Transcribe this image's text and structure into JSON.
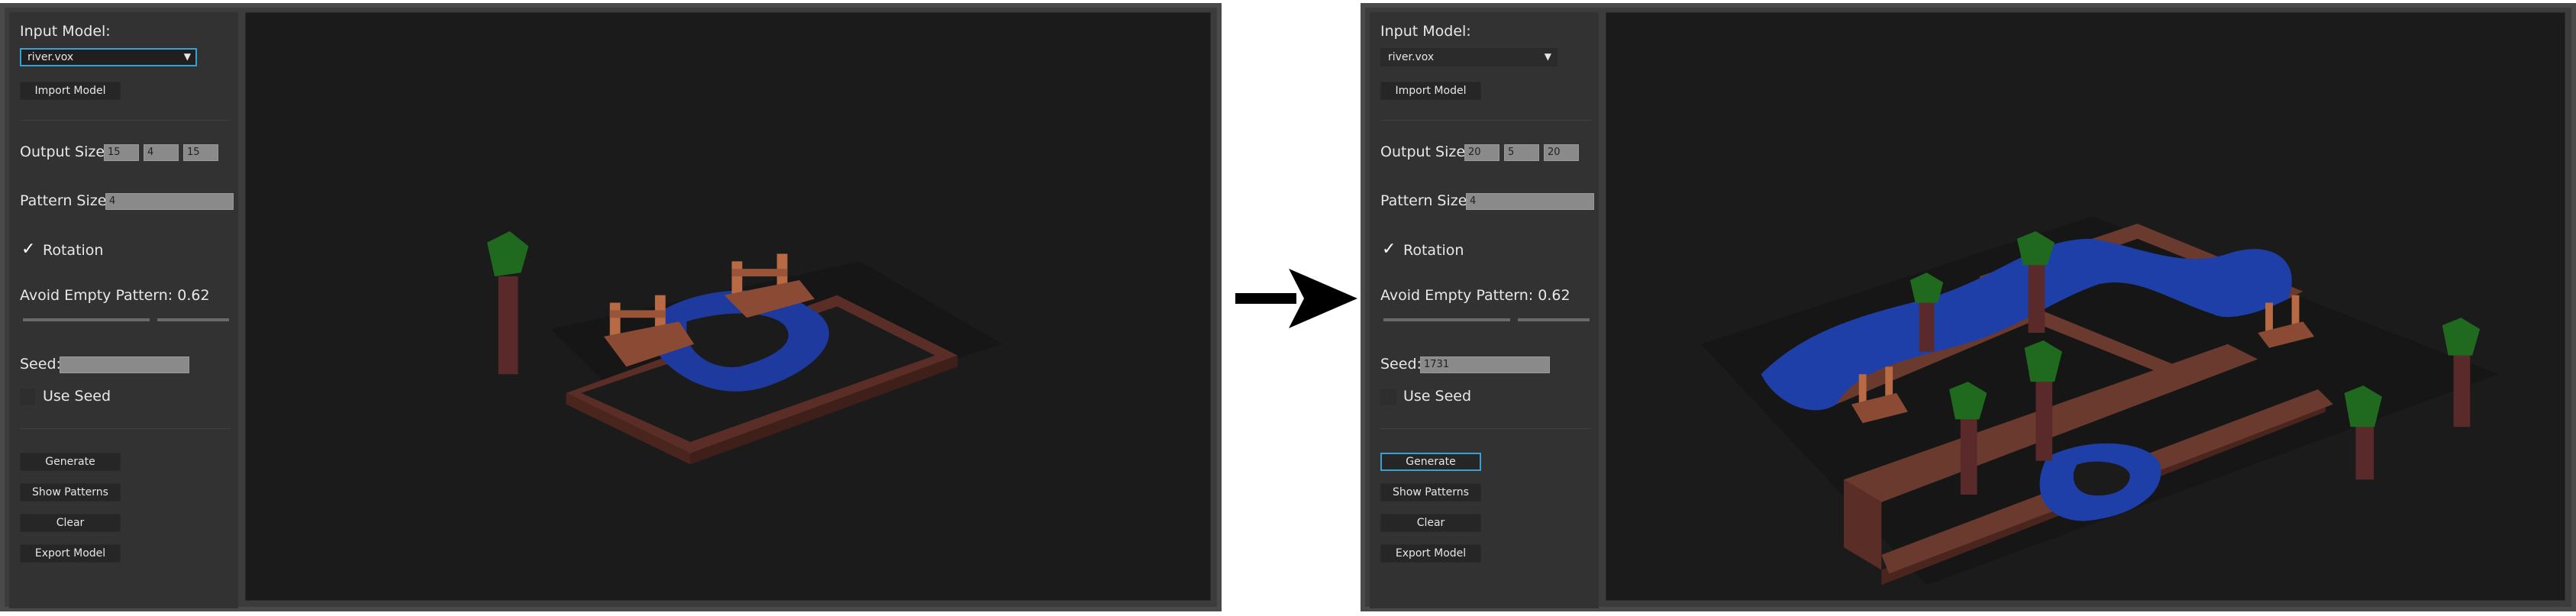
{
  "panels": {
    "left": {
      "input_model_label": "Input Model:",
      "model_selected": "river.vox",
      "import_label": "Import Model",
      "output_size_label": "Output Size:",
      "output_size": [
        "15",
        "4",
        "15"
      ],
      "pattern_size_label": "Pattern Size:",
      "pattern_size": "4",
      "rotation_label": "Rotation",
      "rotation_checked": "✓",
      "avoid_label": "Avoid Empty Pattern: 0.62",
      "avoid_value": 0.62,
      "seed_label": "Seed:",
      "seed_value": "",
      "use_seed_label": "Use Seed",
      "generate_label": "Generate",
      "show_patterns_label": "Show Patterns",
      "clear_label": "Clear",
      "export_label": "Export Model"
    },
    "right": {
      "input_model_label": "Input Model:",
      "model_selected": "river.vox",
      "import_label": "Import Model",
      "output_size_label": "Output Size:",
      "output_size": [
        "20",
        "5",
        "20"
      ],
      "pattern_size_label": "Pattern Size:",
      "pattern_size": "4",
      "rotation_label": "Rotation",
      "rotation_checked": "✓",
      "avoid_label": "Avoid Empty Pattern: 0.62",
      "avoid_value": 0.62,
      "seed_label": "Seed:",
      "seed_value": "1731",
      "use_seed_label": "Use Seed",
      "generate_label": "Generate",
      "show_patterns_label": "Show Patterns",
      "clear_label": "Clear",
      "export_label": "Export Model"
    }
  },
  "icons": {
    "dropdown": "chevron-down-icon",
    "check": "checkmark-icon",
    "arrow": "arrow-right-icon"
  },
  "colors": {
    "accent": "#3aa0d4",
    "panel": "#323232",
    "viewport": "#1b1b1b",
    "water": "#1f3fa8",
    "dirt": "#6b3a2e",
    "tree": "#1f6a1f"
  }
}
